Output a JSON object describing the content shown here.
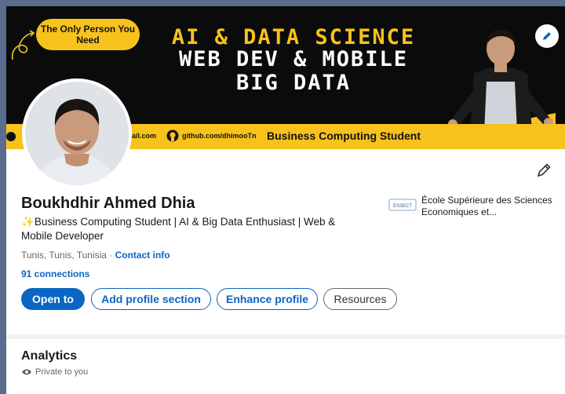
{
  "banner": {
    "pill_text": "The Only Person You Need",
    "line1": "AI & DATA SCIENCE",
    "line2": "WEB DEV & MOBILE",
    "line3": "BIG DATA",
    "strip_email": "ail.com",
    "strip_github": "github.com/dhimooTn",
    "strip_title": "Business Computing Student",
    "colors": {
      "accent": "#f7c21b",
      "background": "#0b0b0b"
    }
  },
  "profile": {
    "name": "Boukhdhir Ahmed Dhia",
    "headline_icon": "✨",
    "headline": "Business Computing Student | AI & Big Data Enthusiast | Web & Mobile Developer",
    "location": "Tunis, Tunis, Tunisia",
    "location_sep": " · ",
    "contact_info": "Contact info",
    "connections": "91 connections",
    "school_logo_text": "ESSECT",
    "school_name": "École Supérieure des Sciences Economiques et..."
  },
  "actions": {
    "open_to": "Open to",
    "add_profile_section": "Add profile section",
    "enhance_profile": "Enhance profile",
    "resources": "Resources"
  },
  "analytics": {
    "title": "Analytics",
    "privacy": "Private to you"
  },
  "colors": {
    "primary": "#0a66c2",
    "text": "#191919",
    "muted": "#666666",
    "page_bg": "#f3f2ef",
    "outer_border": "#5a6c8f"
  },
  "icons": [
    "pencil-icon",
    "github-icon",
    "eye-icon",
    "sparkles-icon"
  ]
}
